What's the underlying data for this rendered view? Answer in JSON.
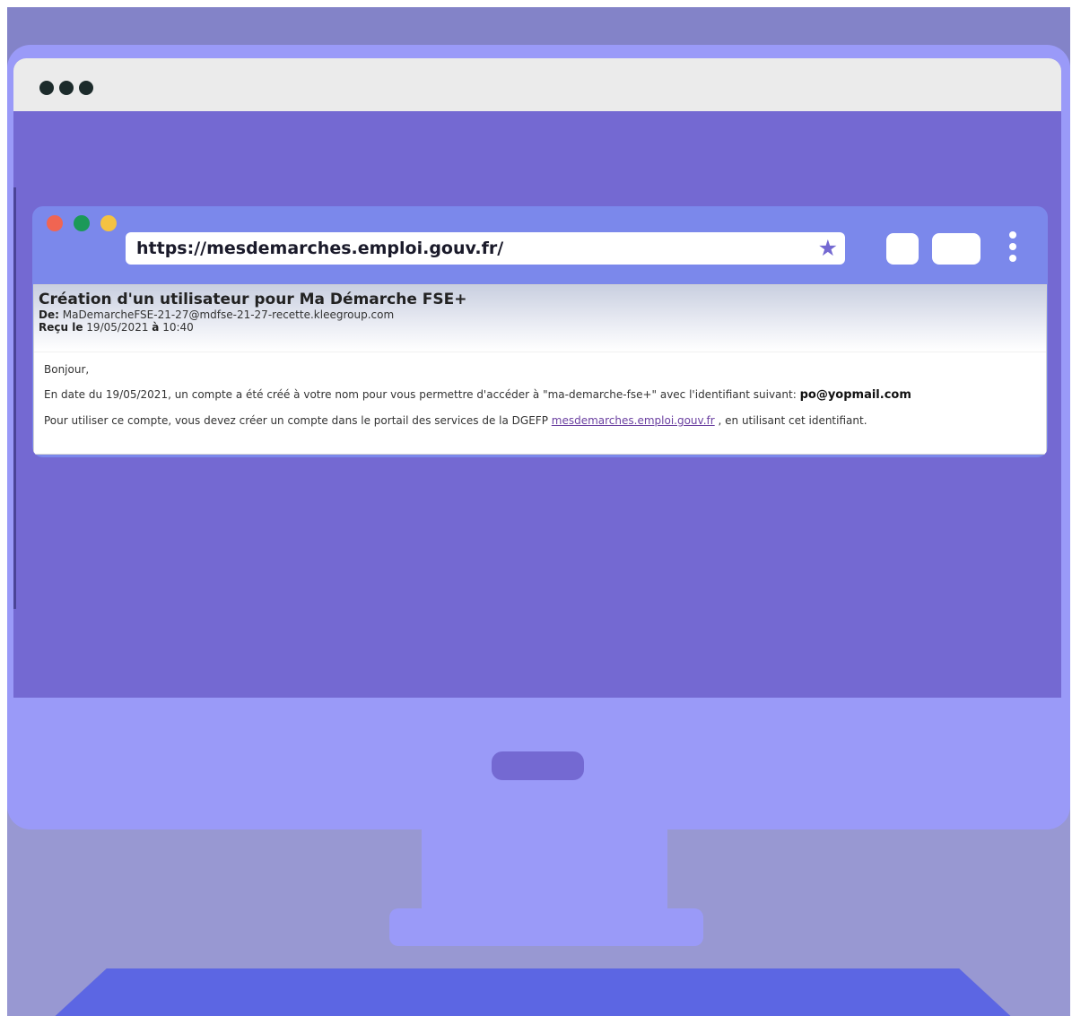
{
  "browser": {
    "url": "https://mesdemarches.emploi.gouv.fr/"
  },
  "email": {
    "subject": "Création d'un utilisateur pour Ma Démarche FSE+",
    "from_label": "De:",
    "from_value": "MaDemarcheFSE-21-27@mdfse-21-27-recette.kleegroup.com",
    "received_label": "Reçu le",
    "received_date": "19/05/2021",
    "received_at": "à",
    "received_time": "10:40",
    "greeting": "Bonjour,",
    "line1_text": "En date du 19/05/2021, un compte a été créé à votre nom pour vous permettre d'accéder à \"ma-demarche-fse+\" avec l'identifiant suivant:",
    "identifier": "po@yopmail.com",
    "line2_before": "Pour utiliser ce compte, vous devez créer un compte dans le portail des services de la DGEFP",
    "portal_link": "mesdemarches.emploi.gouv.fr",
    "line2_after": ", en utilisant cet identifiant."
  },
  "colors": {
    "screen": "#7469d2",
    "monitor": "#9a9af8",
    "browser_bar": "#7b88eb",
    "light_red": "#f06552",
    "light_green": "#1b9958",
    "light_yellow": "#f4c242",
    "star": "#7469d2"
  },
  "icons": {
    "star": "star-icon",
    "menu": "kebab-menu-icon"
  }
}
